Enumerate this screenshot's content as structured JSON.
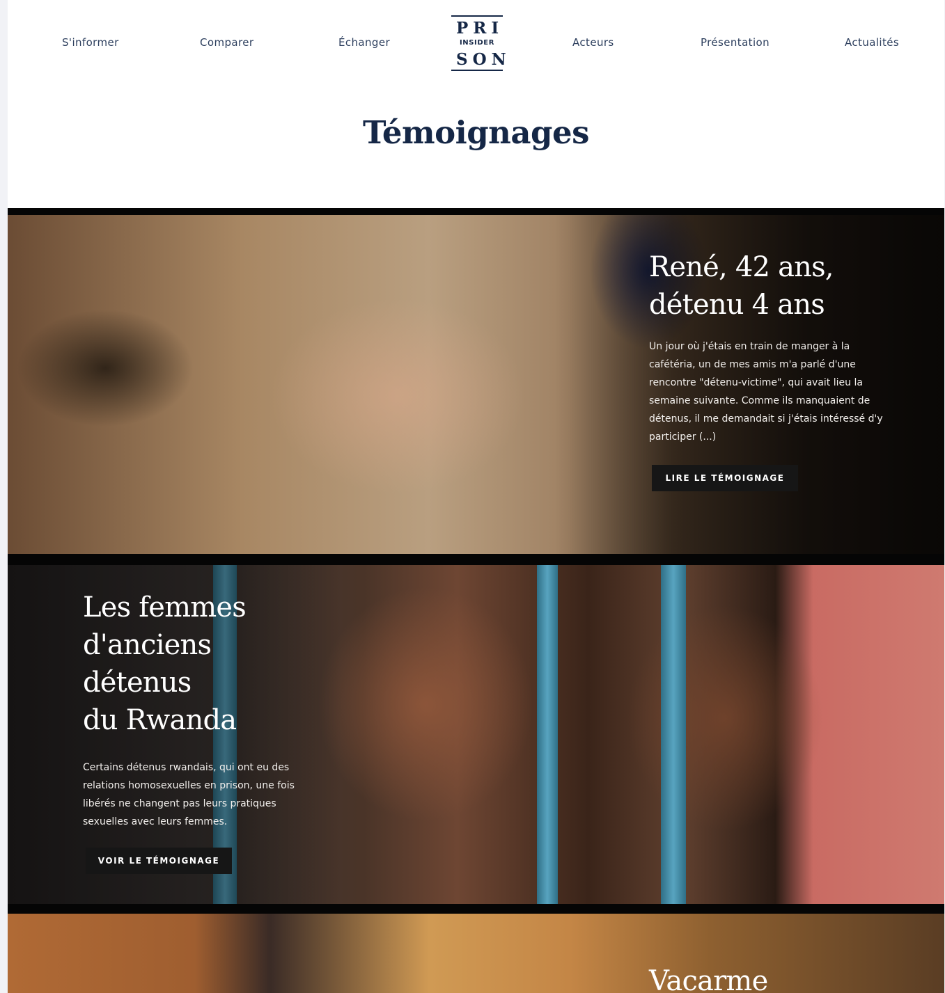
{
  "nav": {
    "items": [
      {
        "label": "S'informer"
      },
      {
        "label": "Comparer"
      },
      {
        "label": "Échanger"
      },
      {
        "label": "Acteurs"
      },
      {
        "label": "Présentation"
      },
      {
        "label": "Actualités"
      }
    ]
  },
  "logo": {
    "line1": "PRI",
    "line2": "INSIDER",
    "line3": "SON"
  },
  "page": {
    "title": "Témoignages"
  },
  "stories": [
    {
      "title_line1": "René, 42 ans,",
      "title_line2": "détenu 4 ans",
      "text": "Un jour où j'étais en train de manger à la cafétéria, un de mes amis m'a parlé d'une rencontre \"détenu-victime\", qui avait lieu la semaine suivante. Comme ils manquaient de détenus, il me demandait si j'étais intéressé d'y participer (...)",
      "button": "LIRE LE TÉMOIGNAGE"
    },
    {
      "title_line1": "Les femmes",
      "title_line2": "d'anciens",
      "title_line3": "détenus",
      "title_line4": "du Rwanda",
      "text": "Certains détenus rwandais, qui ont eu des relations homosexuelles en prison, une fois libérés ne changent pas leurs pratiques sexuelles avec leurs femmes.",
      "button": "VOIR LE TÉMOIGNAGE"
    },
    {
      "title_line1": "Vacarme"
    }
  ]
}
